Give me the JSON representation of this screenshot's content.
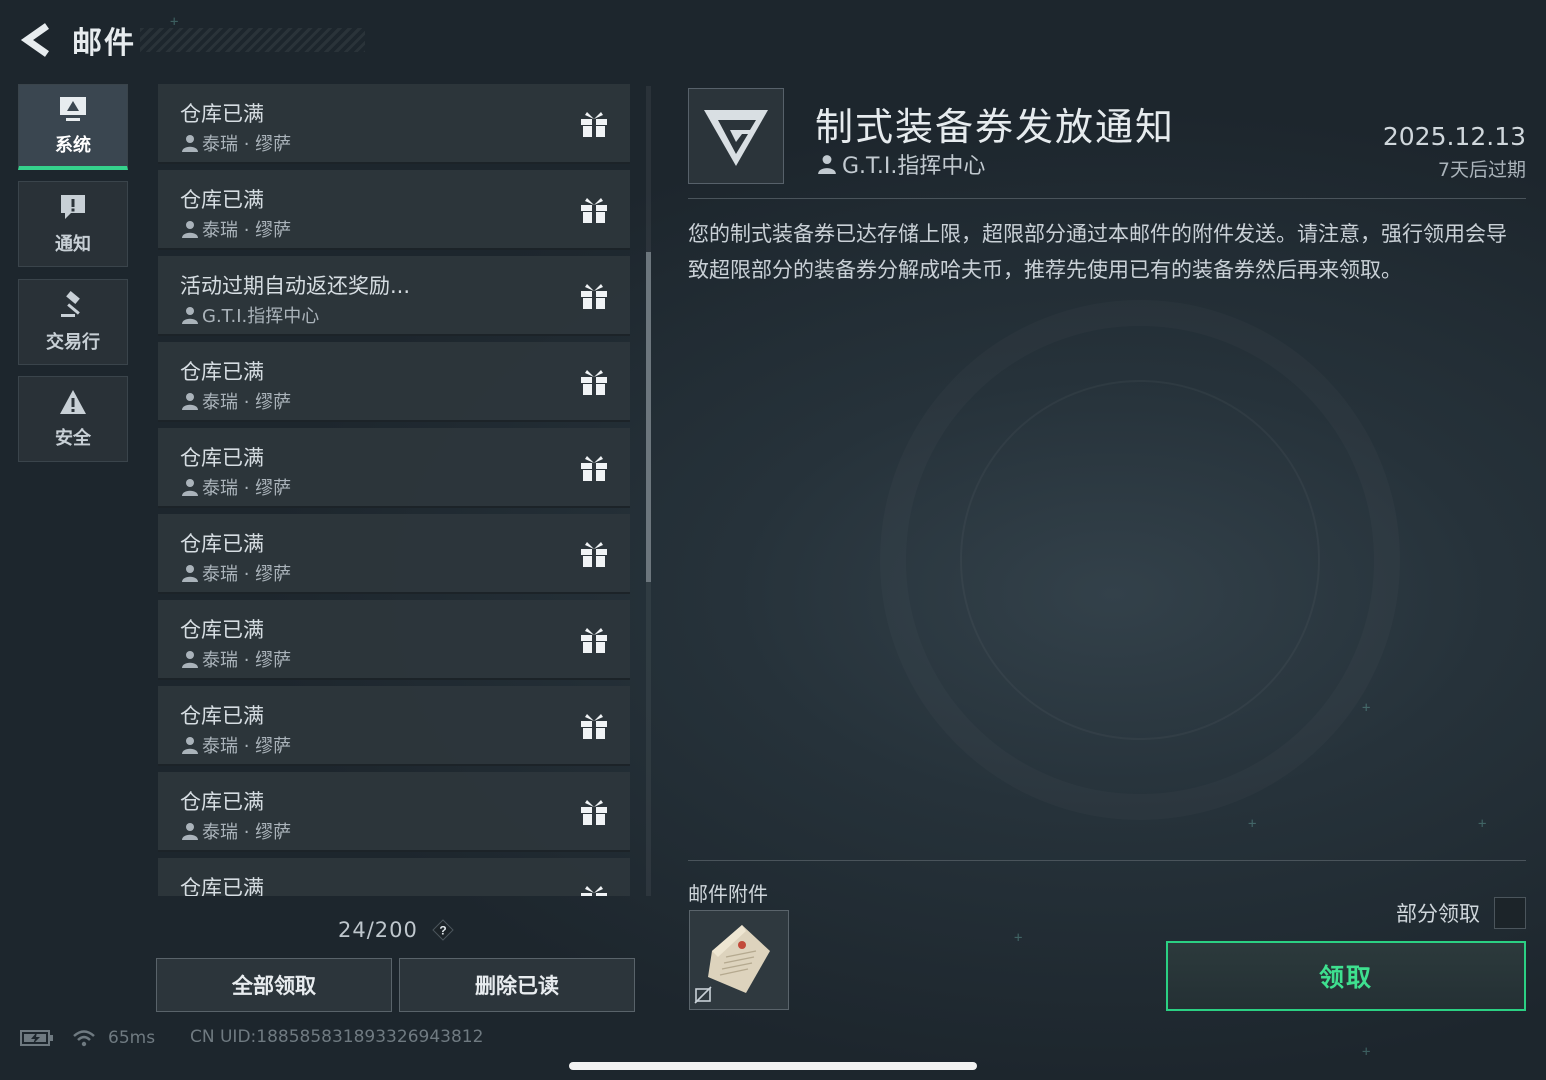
{
  "header": {
    "title": "邮件"
  },
  "categories": [
    {
      "label": "系统",
      "icon": "system-icon",
      "active": true
    },
    {
      "label": "通知",
      "icon": "notification-icon",
      "active": false
    },
    {
      "label": "交易行",
      "icon": "gavel-icon",
      "active": false
    },
    {
      "label": "安全",
      "icon": "warning-icon",
      "active": false
    }
  ],
  "mails": [
    {
      "subject": "仓库已满",
      "sender": "泰瑞 · 缪萨",
      "icon": "gift-icon"
    },
    {
      "subject": "仓库已满",
      "sender": "泰瑞 · 缪萨",
      "icon": "gift-icon"
    },
    {
      "subject": "活动过期自动返还奖励...",
      "sender": "G.T.I.指挥中心",
      "icon": "gift-icon"
    },
    {
      "subject": "仓库已满",
      "sender": "泰瑞 · 缪萨",
      "icon": "gift-icon"
    },
    {
      "subject": "仓库已满",
      "sender": "泰瑞 · 缪萨",
      "icon": "gift-icon"
    },
    {
      "subject": "仓库已满",
      "sender": "泰瑞 · 缪萨",
      "icon": "gift-icon"
    },
    {
      "subject": "仓库已满",
      "sender": "泰瑞 · 缪萨",
      "icon": "gift-icon"
    },
    {
      "subject": "仓库已满",
      "sender": "泰瑞 · 缪萨",
      "icon": "gift-icon"
    },
    {
      "subject": "仓库已满",
      "sender": "泰瑞 · 缪萨",
      "icon": "gift-icon"
    },
    {
      "subject": "仓库已满",
      "sender": "",
      "icon": "gift-icon"
    }
  ],
  "mail_count": "24/200",
  "actions": {
    "claim_all": "全部领取",
    "delete_read": "删除已读"
  },
  "status": {
    "ping": "65ms",
    "uid": "CN UID:1885858318933269438​12"
  },
  "detail": {
    "title": "制式装备券发放通知",
    "sender": "G.T.I.指挥中心",
    "date": "2025.12.13",
    "expiry": "7天后过期",
    "body": "您的制式装备券已达存储上限，超限部分通过本邮件的附件发送。请注意，强行领用会导致超限部分的装备券分解成哈夫币，推荐先使用已有的装备券然后再来领取。",
    "attachment_label": "邮件附件",
    "partial_claim_label": "部分领取",
    "claim_label": "领取"
  },
  "colors": {
    "accent": "#35d28c",
    "claim_text": "#3ee08f"
  }
}
